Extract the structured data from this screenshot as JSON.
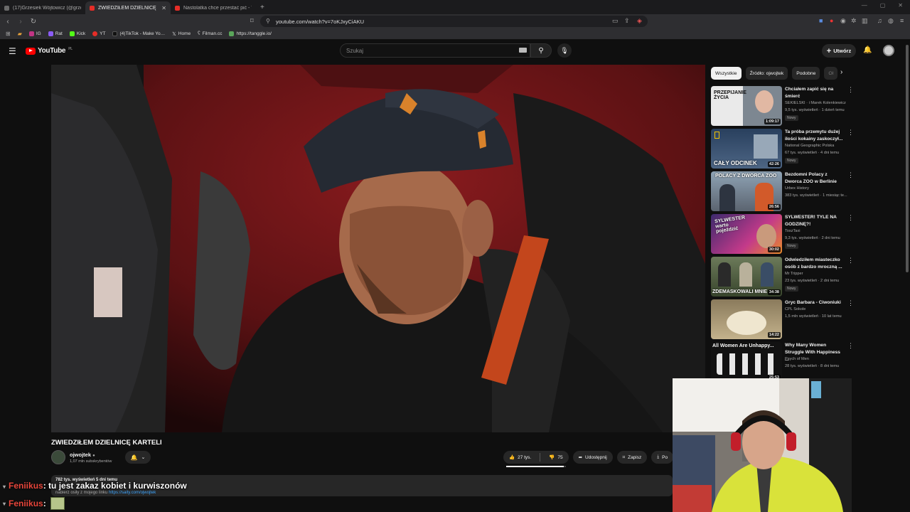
{
  "browser": {
    "tabs": [
      {
        "title": "(17)Grzesiek Wójtowicz (@grzesiek…",
        "color": "#6a6a6a",
        "active": false
      },
      {
        "title": "ZWIEDZIŁEM DZIELNICĘ KAR…",
        "color": "#e52d27",
        "active": true
      },
      {
        "title": "Nastolatka chce przestać pić - YouTu…",
        "color": "#e52d27",
        "active": false
      }
    ],
    "url": "youtube.com/watch?v=7oKJxyCiAKU",
    "bookmarks": [
      "IG",
      "Rat",
      "Kick",
      "YT",
      "(4)TikTok - Make Yo…",
      "Home",
      "Filman.cc",
      "https://tanggle.io/"
    ]
  },
  "youtube": {
    "logo": "YouTube",
    "region": "PL",
    "search_placeholder": "Szukaj",
    "create_label": "Utwórz"
  },
  "video": {
    "title": "ZWIEDZIŁEM DZIELNICĘ KARTELI",
    "channel": "ojwojtek",
    "subscribers": "1,07 mln subskrybentów",
    "likes": "27 tys.",
    "dislikes": "75",
    "share": "Udostępnij",
    "save": "Zapisz",
    "download": "Po",
    "views_age": "782 tys. wyświetleń  5 dni temu",
    "description_snippet": "nabierz osiły z mojego linku",
    "description_link": "https://saity.com/ojwojtek"
  },
  "chat": [
    {
      "nick": "Feniikus",
      "message": ": tu jest zakaz kobiet i kurwiszonów"
    },
    {
      "nick": "Feniikus",
      "message": ":"
    }
  ],
  "sidebar": {
    "chips": [
      "Wszystkie",
      "Źródło: ojwojtek",
      "Podobne",
      "Oł"
    ],
    "recommendations": [
      {
        "title": "Chciałem zapić się na śmierć",
        "channel": "SEKIELSKI · i Marek Kolenkiewicz",
        "meta": "9,5 tys. wyświetleń · 1 dzień temu",
        "badge": "Nowy",
        "duration": "1:09:17",
        "thumb_text": "PRZEPIJANIE ŻYCIA",
        "thumb_color": "#7d8791"
      },
      {
        "title": "Ta próba przemytu dużej ilości kokainy zaskoczył...",
        "channel": "National Geographic Polska",
        "meta": "67 tys. wyświetleń · 4 dni temu",
        "badge": "Nowy",
        "duration": "42:26",
        "thumb_text": "CAŁY ODCINEK",
        "thumb_color": "#29405e"
      },
      {
        "title": "Bezdomni Polacy z Dworca ZOO w Berlinie",
        "channel": "Urbex History",
        "meta": "383 tys. wyświetleń · 1 miesiąc te...",
        "badge": "",
        "duration": "26:56",
        "thumb_text": "POLACY Z DWORCA ZOO",
        "thumb_color": "#5b6470"
      },
      {
        "title": "SYLWESTER! TYLE NA GODZINĘ?!",
        "channel": "ToszTaxi",
        "meta": "9,3 tys. wyświetleń · 2 dni temu",
        "badge": "Nowy",
        "duration": "30:02",
        "thumb_text": "SYLWESTER warto pojeździć",
        "thumb_color": "#3d2a6e"
      },
      {
        "title": "Odwiedziłem miasteczko osób z bardzo mroczną ...",
        "channel": "Mr Tripper",
        "meta": "23 tys. wyświetleń · 2 dni temu",
        "badge": "Nowy",
        "duration": "34:38",
        "thumb_text": "ZDEMASKOWALI MNIE",
        "thumb_color": "#4b5a3c"
      },
      {
        "title": "Gryc Barbara - Ciwoniuki",
        "channel": "CPL Sokole",
        "meta": "1,5 mln wyświetleń · 10 lat temu",
        "badge": "",
        "duration": "14:22",
        "thumb_text": "",
        "thumb_color": "#8a7a5c"
      },
      {
        "title": "Why Many Women Struggle With Happiness ...",
        "channel": "Psych of Men",
        "meta": "28 tys. wyświetleń · 8 dni temu",
        "badge": "",
        "duration": "25:53",
        "thumb_text": "All Women Are Unhappy...",
        "thumb_color": "#121212"
      }
    ]
  }
}
